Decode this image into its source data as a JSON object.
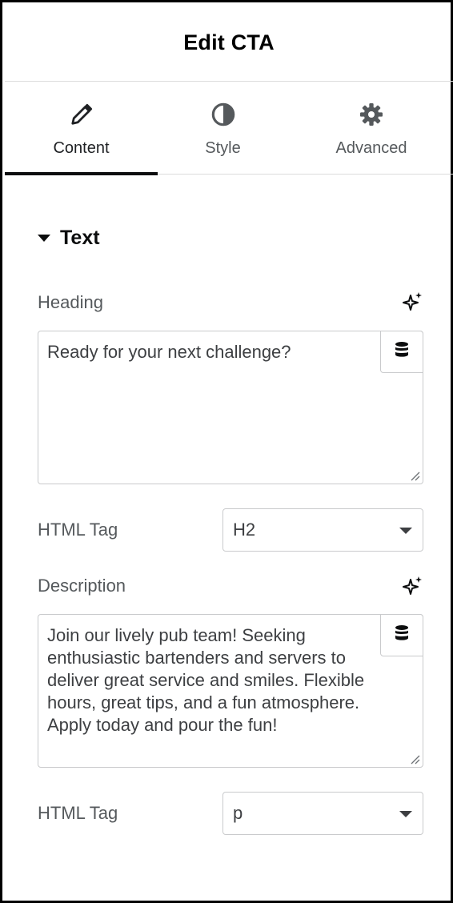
{
  "panel": {
    "title": "Edit CTA"
  },
  "tabs": [
    {
      "label": "Content",
      "icon": "pencil-icon",
      "active": true
    },
    {
      "label": "Style",
      "icon": "contrast-icon",
      "active": false
    },
    {
      "label": "Advanced",
      "icon": "gear-icon",
      "active": false
    }
  ],
  "section": {
    "title": "Text",
    "icon": "caret-down-icon"
  },
  "heading": {
    "label": "Heading",
    "value": "Ready for your next challenge?",
    "ai_icon": "sparkle-icon",
    "dynamic_icon": "database-icon"
  },
  "heading_tag": {
    "label": "HTML Tag",
    "value": "H2"
  },
  "description": {
    "label": "Description",
    "value": "Join our lively pub team! Seeking enthusiastic bartenders and servers to deliver great service and smiles. Flexible hours, great tips, and a fun atmosphere. Apply today and pour the fun!",
    "ai_icon": "sparkle-icon",
    "dynamic_icon": "database-icon"
  },
  "description_tag": {
    "label": "HTML Tag",
    "value": "p"
  },
  "colors": {
    "active_tab_underline": "#0c0d0e",
    "border": "#c9cacc",
    "label": "#55595c"
  }
}
